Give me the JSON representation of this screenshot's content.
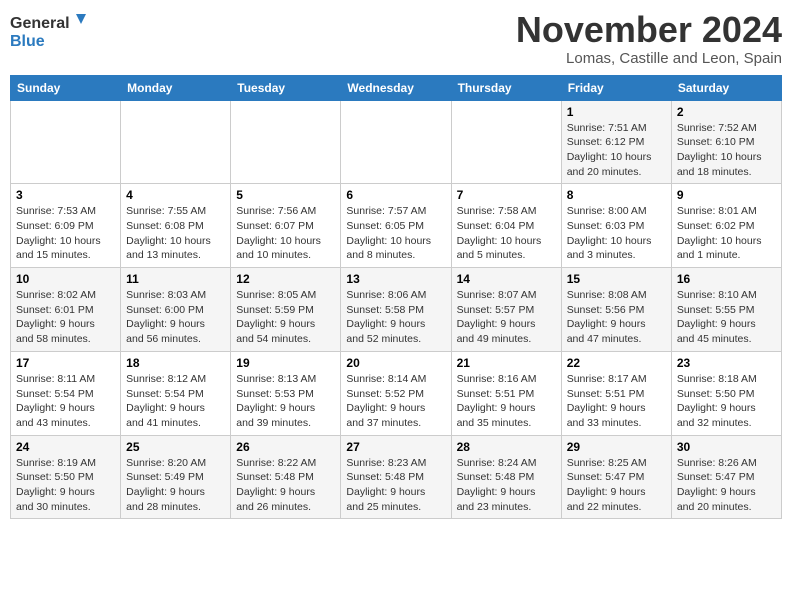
{
  "header": {
    "logo_line1": "General",
    "logo_line2": "Blue",
    "month": "November 2024",
    "location": "Lomas, Castille and Leon, Spain"
  },
  "days_of_week": [
    "Sunday",
    "Monday",
    "Tuesday",
    "Wednesday",
    "Thursday",
    "Friday",
    "Saturday"
  ],
  "weeks": [
    [
      {
        "day": "",
        "info": ""
      },
      {
        "day": "",
        "info": ""
      },
      {
        "day": "",
        "info": ""
      },
      {
        "day": "",
        "info": ""
      },
      {
        "day": "",
        "info": ""
      },
      {
        "day": "1",
        "info": "Sunrise: 7:51 AM\nSunset: 6:12 PM\nDaylight: 10 hours and 20 minutes."
      },
      {
        "day": "2",
        "info": "Sunrise: 7:52 AM\nSunset: 6:10 PM\nDaylight: 10 hours and 18 minutes."
      }
    ],
    [
      {
        "day": "3",
        "info": "Sunrise: 7:53 AM\nSunset: 6:09 PM\nDaylight: 10 hours and 15 minutes."
      },
      {
        "day": "4",
        "info": "Sunrise: 7:55 AM\nSunset: 6:08 PM\nDaylight: 10 hours and 13 minutes."
      },
      {
        "day": "5",
        "info": "Sunrise: 7:56 AM\nSunset: 6:07 PM\nDaylight: 10 hours and 10 minutes."
      },
      {
        "day": "6",
        "info": "Sunrise: 7:57 AM\nSunset: 6:05 PM\nDaylight: 10 hours and 8 minutes."
      },
      {
        "day": "7",
        "info": "Sunrise: 7:58 AM\nSunset: 6:04 PM\nDaylight: 10 hours and 5 minutes."
      },
      {
        "day": "8",
        "info": "Sunrise: 8:00 AM\nSunset: 6:03 PM\nDaylight: 10 hours and 3 minutes."
      },
      {
        "day": "9",
        "info": "Sunrise: 8:01 AM\nSunset: 6:02 PM\nDaylight: 10 hours and 1 minute."
      }
    ],
    [
      {
        "day": "10",
        "info": "Sunrise: 8:02 AM\nSunset: 6:01 PM\nDaylight: 9 hours and 58 minutes."
      },
      {
        "day": "11",
        "info": "Sunrise: 8:03 AM\nSunset: 6:00 PM\nDaylight: 9 hours and 56 minutes."
      },
      {
        "day": "12",
        "info": "Sunrise: 8:05 AM\nSunset: 5:59 PM\nDaylight: 9 hours and 54 minutes."
      },
      {
        "day": "13",
        "info": "Sunrise: 8:06 AM\nSunset: 5:58 PM\nDaylight: 9 hours and 52 minutes."
      },
      {
        "day": "14",
        "info": "Sunrise: 8:07 AM\nSunset: 5:57 PM\nDaylight: 9 hours and 49 minutes."
      },
      {
        "day": "15",
        "info": "Sunrise: 8:08 AM\nSunset: 5:56 PM\nDaylight: 9 hours and 47 minutes."
      },
      {
        "day": "16",
        "info": "Sunrise: 8:10 AM\nSunset: 5:55 PM\nDaylight: 9 hours and 45 minutes."
      }
    ],
    [
      {
        "day": "17",
        "info": "Sunrise: 8:11 AM\nSunset: 5:54 PM\nDaylight: 9 hours and 43 minutes."
      },
      {
        "day": "18",
        "info": "Sunrise: 8:12 AM\nSunset: 5:54 PM\nDaylight: 9 hours and 41 minutes."
      },
      {
        "day": "19",
        "info": "Sunrise: 8:13 AM\nSunset: 5:53 PM\nDaylight: 9 hours and 39 minutes."
      },
      {
        "day": "20",
        "info": "Sunrise: 8:14 AM\nSunset: 5:52 PM\nDaylight: 9 hours and 37 minutes."
      },
      {
        "day": "21",
        "info": "Sunrise: 8:16 AM\nSunset: 5:51 PM\nDaylight: 9 hours and 35 minutes."
      },
      {
        "day": "22",
        "info": "Sunrise: 8:17 AM\nSunset: 5:51 PM\nDaylight: 9 hours and 33 minutes."
      },
      {
        "day": "23",
        "info": "Sunrise: 8:18 AM\nSunset: 5:50 PM\nDaylight: 9 hours and 32 minutes."
      }
    ],
    [
      {
        "day": "24",
        "info": "Sunrise: 8:19 AM\nSunset: 5:50 PM\nDaylight: 9 hours and 30 minutes."
      },
      {
        "day": "25",
        "info": "Sunrise: 8:20 AM\nSunset: 5:49 PM\nDaylight: 9 hours and 28 minutes."
      },
      {
        "day": "26",
        "info": "Sunrise: 8:22 AM\nSunset: 5:48 PM\nDaylight: 9 hours and 26 minutes."
      },
      {
        "day": "27",
        "info": "Sunrise: 8:23 AM\nSunset: 5:48 PM\nDaylight: 9 hours and 25 minutes."
      },
      {
        "day": "28",
        "info": "Sunrise: 8:24 AM\nSunset: 5:48 PM\nDaylight: 9 hours and 23 minutes."
      },
      {
        "day": "29",
        "info": "Sunrise: 8:25 AM\nSunset: 5:47 PM\nDaylight: 9 hours and 22 minutes."
      },
      {
        "day": "30",
        "info": "Sunrise: 8:26 AM\nSunset: 5:47 PM\nDaylight: 9 hours and 20 minutes."
      }
    ]
  ]
}
